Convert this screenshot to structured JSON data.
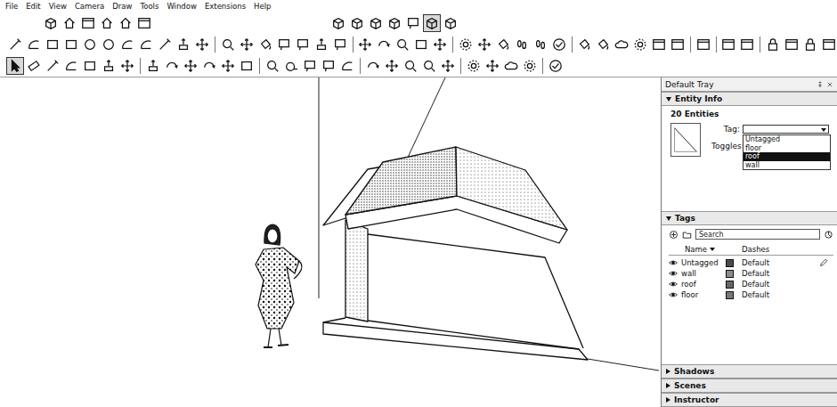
{
  "menu": [
    "File",
    "Edit",
    "View",
    "Camera",
    "Draw",
    "Tools",
    "Window",
    "Extensions",
    "Help"
  ],
  "toolbars": [
    [
      [
        {
          "selected": false
        },
        {
          "selected": false
        },
        {
          "selected": false
        },
        {
          "selected": false
        },
        {
          "selected": false
        },
        {
          "selected": false
        }
      ],
      [
        {
          "selected": false
        },
        {
          "selected": false
        },
        {
          "selected": false
        },
        {
          "selected": false
        },
        {
          "selected": false
        },
        {
          "selected": true
        },
        {
          "selected": false
        }
      ]
    ],
    [
      [
        {
          "selected": false
        },
        {
          "selected": false
        },
        {
          "selected": false
        },
        {
          "selected": false
        },
        {
          "selected": false
        },
        {
          "selected": false
        },
        {
          "selected": false
        },
        {
          "selected": false
        },
        {
          "selected": false
        },
        {
          "selected": false
        },
        {
          "selected": false
        }
      ],
      [
        {
          "selected": false
        },
        {
          "selected": false
        },
        {
          "selected": false
        },
        {
          "selected": false
        },
        {
          "selected": false
        },
        {
          "selected": false
        },
        {
          "selected": false
        }
      ],
      [
        {
          "selected": false
        },
        {
          "selected": false
        },
        {
          "selected": false
        },
        {
          "selected": false
        },
        {
          "selected": false
        }
      ],
      [
        {
          "selected": false
        },
        {
          "selected": false
        },
        {
          "selected": false
        },
        {
          "selected": false
        },
        {
          "selected": false
        },
        {
          "selected": false
        }
      ],
      [
        {
          "selected": false
        },
        {
          "selected": false
        },
        {
          "selected": false
        },
        {
          "selected": false
        },
        {
          "selected": false
        },
        {
          "selected": false
        }
      ],
      [
        {
          "selected": false
        }
      ],
      [
        {
          "selected": false
        },
        {
          "selected": false
        }
      ],
      [
        {
          "selected": false
        },
        {
          "selected": false
        },
        {
          "selected": false
        },
        {
          "selected": false
        }
      ]
    ],
    [
      [
        {
          "selected": true
        },
        {
          "selected": false
        },
        {
          "selected": false
        },
        {
          "selected": false
        },
        {
          "selected": false
        },
        {
          "selected": false
        },
        {
          "selected": false
        }
      ],
      [
        {
          "selected": false
        },
        {
          "selected": false
        },
        {
          "selected": false
        },
        {
          "selected": false
        },
        {
          "selected": false
        },
        {
          "selected": false
        }
      ],
      [
        {
          "selected": false
        },
        {
          "selected": false
        },
        {
          "selected": false
        },
        {
          "selected": false
        },
        {
          "selected": false
        }
      ],
      [
        {
          "selected": false
        },
        {
          "selected": false
        },
        {
          "selected": false
        },
        {
          "selected": false
        },
        {
          "selected": false
        }
      ],
      [
        {
          "selected": false
        },
        {
          "selected": false
        },
        {
          "selected": false
        },
        {
          "selected": false
        }
      ],
      [
        {
          "selected": false
        }
      ]
    ]
  ],
  "tray": {
    "title": "Default Tray"
  },
  "entity_info": {
    "header": "Entity Info",
    "expanded": true,
    "count": "20 Entities",
    "tag_label": "Tag:",
    "toggles_label": "Toggles:",
    "tag_dropdown": {
      "expanded": true,
      "options": [
        {
          "label": "Untagged",
          "selected": false
        },
        {
          "label": "floor",
          "selected": false
        },
        {
          "label": "roof",
          "selected": true
        },
        {
          "label": "wall",
          "selected": false
        }
      ]
    }
  },
  "tags": {
    "header": "Tags",
    "expanded": true,
    "search": {
      "placeholder": "Search"
    },
    "columns": [
      "Name",
      "Dashes"
    ],
    "rows": [
      {
        "name": "Untagged",
        "visible": true,
        "dashes": "Default",
        "current": true,
        "color": "#4a4a4a"
      },
      {
        "name": "wall",
        "visible": true,
        "dashes": "Default",
        "current": false,
        "color": "#8c8c8c"
      },
      {
        "name": "roof",
        "visible": true,
        "dashes": "Default",
        "current": false,
        "color": "#666666"
      },
      {
        "name": "floor",
        "visible": true,
        "dashes": "Default",
        "current": false,
        "color": "#777777"
      }
    ]
  },
  "collapsed_sections": [
    {
      "label": "Shadows",
      "expanded": false
    },
    {
      "label": "Scenes",
      "expanded": false
    },
    {
      "label": "Instructor",
      "expanded": false
    }
  ]
}
